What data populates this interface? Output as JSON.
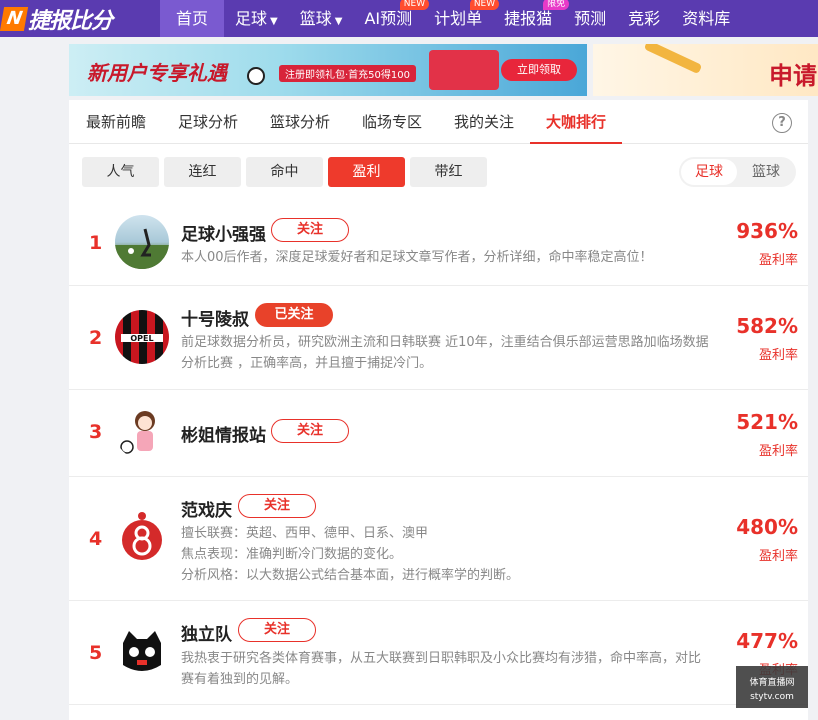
{
  "nav": {
    "logo_text": "捷报比分",
    "items": [
      {
        "label": "首页",
        "active": true,
        "caret": false,
        "badge": ""
      },
      {
        "label": "足球",
        "caret": true,
        "badge": ""
      },
      {
        "label": "篮球",
        "caret": true,
        "badge": ""
      },
      {
        "label": "AI预测",
        "caret": false,
        "badge": "NEW"
      },
      {
        "label": "计划单",
        "caret": false,
        "badge": "NEW"
      },
      {
        "label": "捷报猫",
        "caret": false,
        "badge": "限免"
      },
      {
        "label": "预测",
        "caret": false,
        "badge": ""
      },
      {
        "label": "竞彩",
        "caret": false,
        "badge": ""
      },
      {
        "label": "资料库",
        "caret": false,
        "badge": ""
      }
    ]
  },
  "banners": {
    "b1_title": "新用户专享礼遇",
    "b1_sub": "注册即领礼包·首充50得100",
    "b1_button": "立即领取",
    "b2_text": "申请"
  },
  "tabs": [
    "最新前瞻",
    "足球分析",
    "篮球分析",
    "临场专区",
    "我的关注",
    "大咖排行"
  ],
  "active_tab": "大咖排行",
  "help_icon": "?",
  "filters": [
    "人气",
    "连红",
    "命中",
    "盈利",
    "带红"
  ],
  "active_filter": "盈利",
  "sport_toggle": [
    "足球",
    "篮球"
  ],
  "active_sport": "足球",
  "ranking": [
    {
      "rank": "1",
      "name": "足球小强强",
      "follow": "关注",
      "followed": false,
      "desc": [
        "本人00后作者，深度足球爱好者和足球文章写作者，分析详细，命中率稳定高位！"
      ],
      "pct": "936%",
      "pct_label": "盈利率"
    },
    {
      "rank": "2",
      "name": "十号陵叔",
      "follow": "已关注",
      "followed": true,
      "desc": [
        "前足球数据分析员，研究欧洲主流和日韩联赛 近10年，注重结合俱乐部运营思路加临场数据分析比赛 ，正确率高，并且擅于捕捉冷门。"
      ],
      "pct": "582%",
      "pct_label": "盈利率"
    },
    {
      "rank": "3",
      "name": "彬姐情报站",
      "follow": "关注",
      "followed": false,
      "desc": [],
      "pct": "521%",
      "pct_label": "盈利率"
    },
    {
      "rank": "4",
      "name": "范戏庆",
      "follow": "关注",
      "followed": false,
      "desc": [
        "擅长联赛：英超、西甲、德甲、日系、澳甲",
        "焦点表现：准确判断冷门数据的变化。",
        "分析风格：以大数据公式结合基本面，进行概率学的判断。"
      ],
      "pct": "480%",
      "pct_label": "盈利率"
    },
    {
      "rank": "5",
      "name": "独立队",
      "follow": "关注",
      "followed": false,
      "desc": [
        "我热衷于研究各类体育赛事，从五大联赛到日职韩职及小众比赛均有涉猎，命中率高，对比赛有着独到的见解。"
      ],
      "pct": "477%",
      "pct_label": "盈利率"
    }
  ],
  "watermark": {
    "line1": "体育直播网",
    "line2": "stytv.com"
  }
}
